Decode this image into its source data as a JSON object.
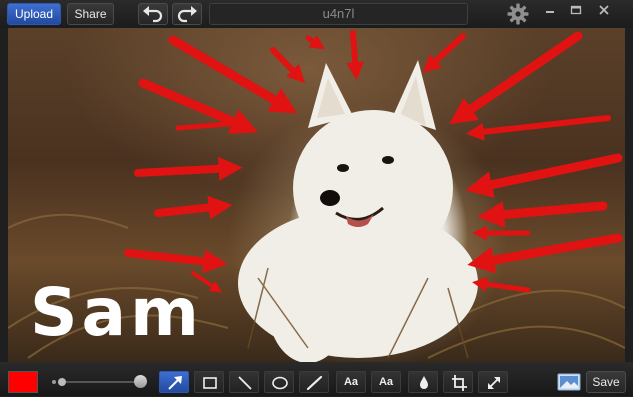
{
  "toolbar": {
    "upload_label": "Upload",
    "share_label": "Share",
    "undo_icon": "undo-icon",
    "redo_icon": "redo-icon",
    "title": "u4n7l",
    "settings_icon": "gear-icon"
  },
  "canvas": {
    "annotation_text": "Sam",
    "arrow_color": "#e01212"
  },
  "bottom": {
    "color_swatch": "#ff0000",
    "text_tool_label": "Aa",
    "text_bg_tool_label": "Aa",
    "save_label": "Save"
  },
  "colors": {
    "accent": "#2f5fc4"
  }
}
